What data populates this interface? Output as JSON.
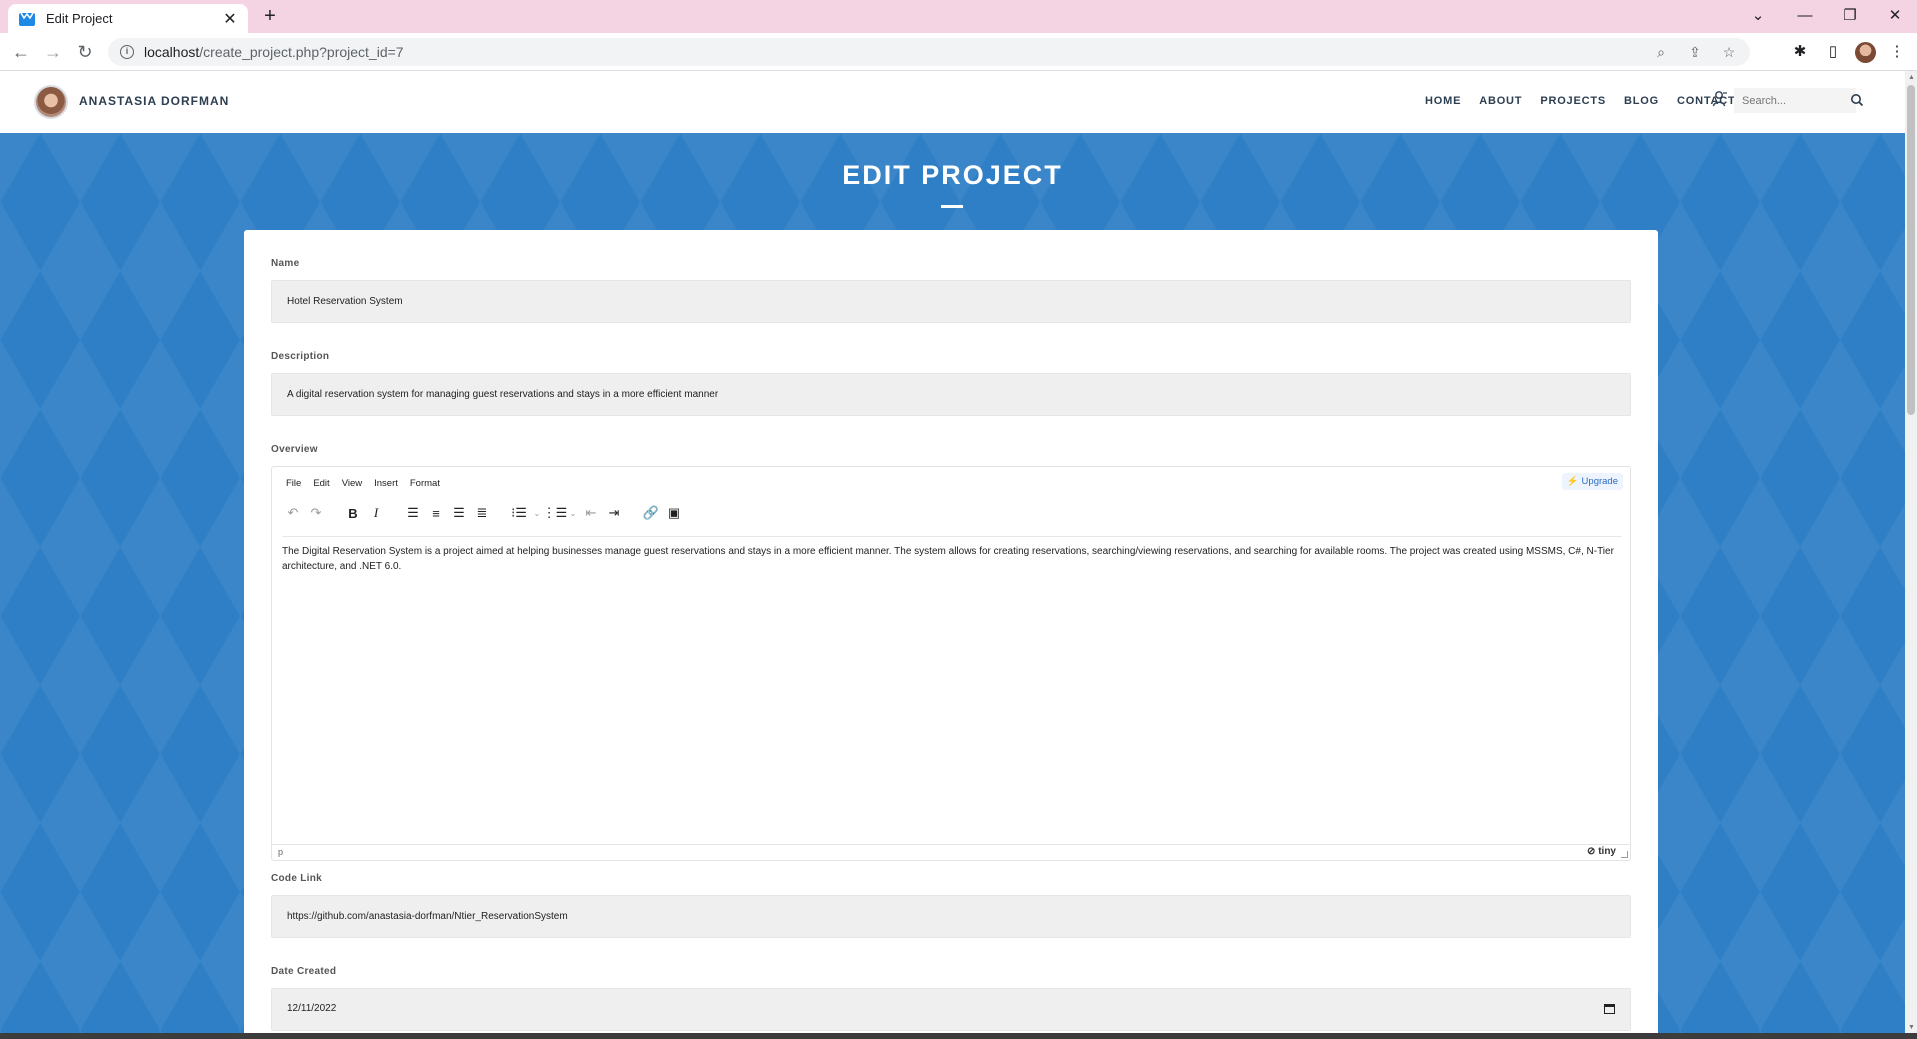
{
  "browser": {
    "tab_title": "Edit Project",
    "url_host": "localhost",
    "url_path": "/create_project.php?project_id=7"
  },
  "site": {
    "brand": "ANASTASIA DORFMAN",
    "nav": [
      "HOME",
      "ABOUT",
      "PROJECTS",
      "BLOG",
      "CONTACT"
    ],
    "search_placeholder": "Search..."
  },
  "page": {
    "title": "EDIT PROJECT"
  },
  "form": {
    "name_label": "Name",
    "name_value": "Hotel Reservation System",
    "description_label": "Description",
    "description_value": "A digital reservation system for managing guest reservations and stays in a more efficient manner",
    "overview_label": "Overview",
    "code_link_label": "Code Link",
    "code_link_value": "https://github.com/anastasia-dorfman/Ntier_ReservationSystem",
    "date_created_label": "Date Created",
    "date_created_value": "12/11/2022"
  },
  "editor": {
    "menu": [
      "File",
      "Edit",
      "View",
      "Insert",
      "Format"
    ],
    "upgrade_label": "Upgrade",
    "content": "The Digital Reservation System is a project aimed at helping businesses manage guest reservations and stays in a more efficient manner. The system allows for creating reservations, searching/viewing reservations, and searching for available rooms. The project was created using MSSMS, C#, N-Tier architecture, and .NET 6.0.",
    "status_path": "p",
    "brand": "tiny"
  }
}
